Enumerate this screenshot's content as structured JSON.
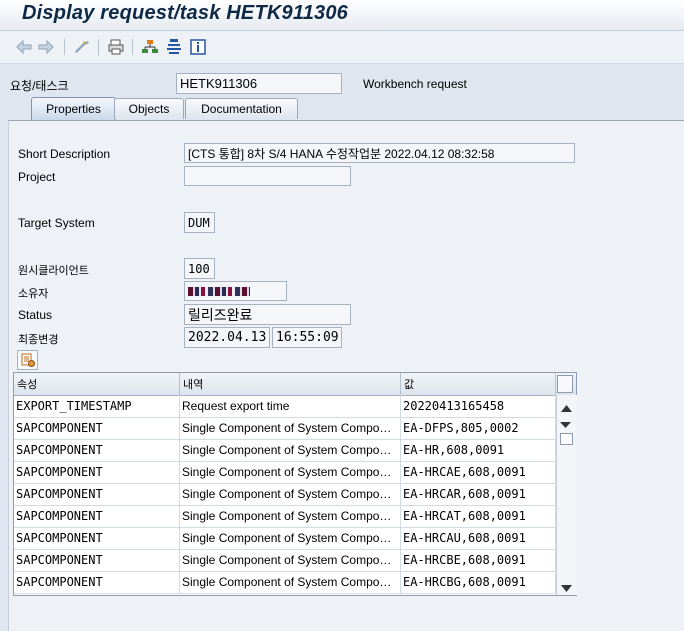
{
  "window": {
    "title": "Display request/task HETK911306"
  },
  "toolbar": {
    "icons": [
      "back-arrow-icon",
      "forward-arrow-icon",
      "display-change-icon",
      "print-icon",
      "hierarchy-icon",
      "org-chart-icon",
      "info-icon"
    ]
  },
  "header": {
    "req_label": "요청/태스크",
    "req_value": "HETK911306",
    "req_type": "Workbench request"
  },
  "tabs": [
    {
      "label": "Properties",
      "active": true
    },
    {
      "label": "Objects"
    },
    {
      "label": "Documentation"
    }
  ],
  "properties": {
    "short_desc_label": "Short Description",
    "short_desc_value": "[CTS 통합] 8차 S/4 HANA 수정작업분 2022.04.12  08:32:58",
    "project_label": "Project",
    "project_value": "",
    "target_system_label": "Target System",
    "target_system_value": "DUM",
    "source_client_label": "원시클라이언트",
    "source_client_value": "100",
    "owner_label": "소유자",
    "status_label": "Status",
    "status_value": "릴리즈완료",
    "last_changed_label": "최종변경",
    "last_changed_date": "2022.04.13",
    "last_changed_time": "16:55:09"
  },
  "grid": {
    "headers": [
      "속성",
      "내역",
      "값"
    ],
    "rows": [
      {
        "attr": "EXPORT_TIMESTAMP",
        "desc": "Request export time",
        "value": "20220413165458"
      },
      {
        "attr": "SAPCOMPONENT",
        "desc": "Single Component of System Compo…",
        "value": "EA-DFPS,805,0002"
      },
      {
        "attr": "SAPCOMPONENT",
        "desc": "Single Component of System Compo…",
        "value": "EA-HR,608,0091"
      },
      {
        "attr": "SAPCOMPONENT",
        "desc": "Single Component of System Compo…",
        "value": "EA-HRCAE,608,0091"
      },
      {
        "attr": "SAPCOMPONENT",
        "desc": "Single Component of System Compo…",
        "value": "EA-HRCAR,608,0091"
      },
      {
        "attr": "SAPCOMPONENT",
        "desc": "Single Component of System Compo…",
        "value": "EA-HRCAT,608,0091"
      },
      {
        "attr": "SAPCOMPONENT",
        "desc": "Single Component of System Compo…",
        "value": "EA-HRCAU,608,0091"
      },
      {
        "attr": "SAPCOMPONENT",
        "desc": "Single Component of System Compo…",
        "value": "EA-HRCBE,608,0091"
      },
      {
        "attr": "SAPCOMPONENT",
        "desc": "Single Component of System Compo…",
        "value": "EA-HRCBG,608,0091"
      }
    ]
  }
}
